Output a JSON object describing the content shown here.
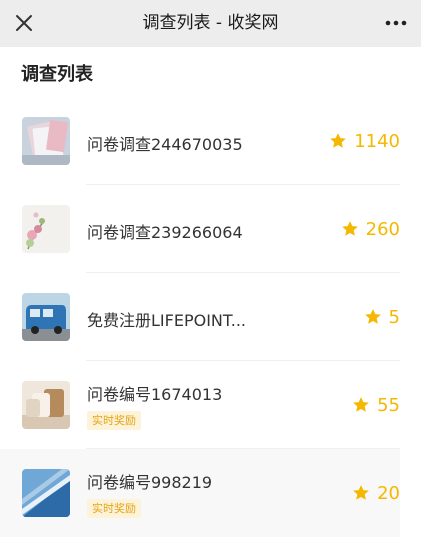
{
  "header": {
    "title": "调查列表 - 收奖网",
    "close_icon": "close-icon",
    "more_icon": "more-icon"
  },
  "section_title": "调查列表",
  "colors": {
    "accent": "#f5b800",
    "badge_bg": "#fdf3d8",
    "badge_text": "#e6a317"
  },
  "surveys": [
    {
      "name": "问卷调查244670035",
      "reward": "1140",
      "badge": "",
      "thumb": "notebook"
    },
    {
      "name": "问卷调查239266064",
      "reward": "260",
      "badge": "",
      "thumb": "flowers"
    },
    {
      "name": "免费注册LIFEPOINT...",
      "reward": "5",
      "badge": "",
      "thumb": "van"
    },
    {
      "name": "问卷编号1674013",
      "reward": "55",
      "badge": "实时奖励",
      "thumb": "pillows"
    },
    {
      "name": "问卷编号998219",
      "reward": "20",
      "badge": "实时奖励",
      "thumb": "building"
    }
  ]
}
